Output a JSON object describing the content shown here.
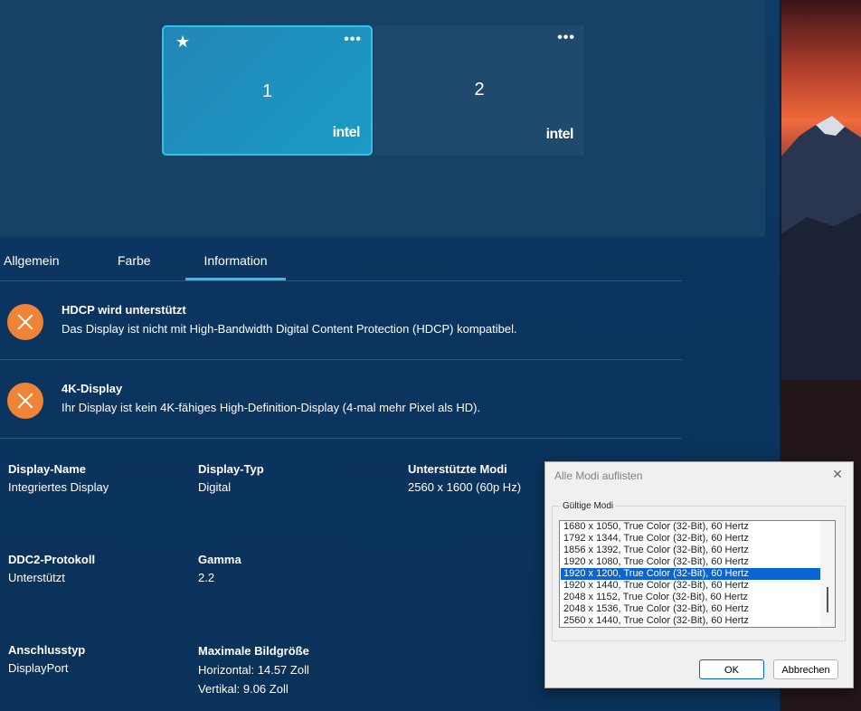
{
  "monitors": [
    {
      "number": "1",
      "brand": "intel",
      "menu": "•••",
      "primary_icon": "★"
    },
    {
      "number": "2",
      "brand": "intel",
      "menu": "•••"
    }
  ],
  "tabs": [
    "Allgemein",
    "Farbe",
    "Information"
  ],
  "active_tab": "Information",
  "info_items": [
    {
      "title": "HDCP wird unterstützt",
      "description": "Das Display ist nicht mit High-Bandwidth Digital Content Protection (HDCP) kompatibel.",
      "icon": "x-icon"
    },
    {
      "title": "4K-Display",
      "description": "Ihr Display ist kein 4K-fähiges High-Definition-Display (4-mal mehr Pixel als HD).",
      "icon": "x-icon"
    }
  ],
  "properties": {
    "display_name": {
      "label": "Display-Name",
      "value": "Integriertes Display"
    },
    "display_type": {
      "label": "Display-Typ",
      "value": "Digital"
    },
    "supported_modes": {
      "label": "Unterstützte Modi",
      "value": "2560 x 1600 (60p Hz)"
    },
    "ddc2": {
      "label": "DDC2-Protokoll",
      "value": "Unterstützt"
    },
    "gamma": {
      "label": "Gamma",
      "value": "2.2"
    },
    "connection": {
      "label": "Anschlusstyp",
      "value": "DisplayPort"
    },
    "max_image_size": {
      "label": "Maximale Bildgröße",
      "horizontal": "Horizontal: 14.57 Zoll",
      "vertical": "Vertikal: 9.06 Zoll"
    }
  },
  "dialog": {
    "title": "Alle Modi auflisten",
    "close_glyph": "✕",
    "group_label": "Gültige Modi",
    "modes": [
      "1680 x 1050, True Color (32-Bit), 60 Hertz",
      "1792 x 1344, True Color (32-Bit), 60 Hertz",
      "1856 x 1392, True Color (32-Bit), 60 Hertz",
      "1920 x 1080, True Color (32-Bit), 60 Hertz",
      "1920 x 1200, True Color (32-Bit), 60 Hertz",
      "1920 x 1440, True Color (32-Bit), 60 Hertz",
      "2048 x 1152, True Color (32-Bit), 60 Hertz",
      "2048 x 1536, True Color (32-Bit), 60 Hertz",
      "2560 x 1440, True Color (32-Bit), 60 Hertz"
    ],
    "selected_mode": "1920 x 1200, True Color (32-Bit), 60 Hertz",
    "ok_label": "OK",
    "cancel_label": "Abbrechen"
  },
  "colors": {
    "accent": "#3db7ee",
    "warning": "#f08436",
    "selection": "#0a64d2"
  }
}
